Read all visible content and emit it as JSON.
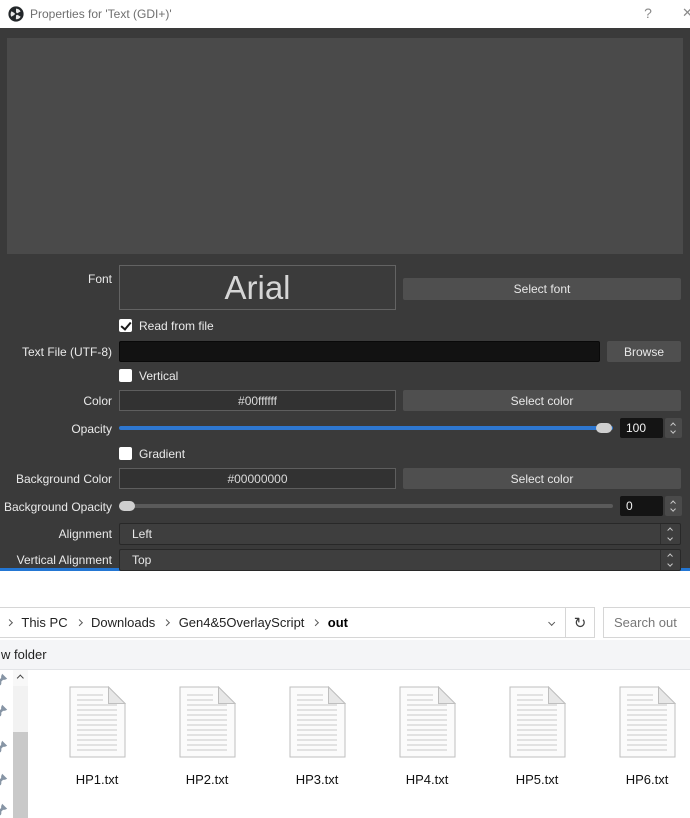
{
  "titlebar": {
    "title": "Properties for 'Text (GDI+)'",
    "help": "?",
    "close": "✕"
  },
  "dialog": {
    "font_label": "Font",
    "font_value": "Arial",
    "select_font_button": "Select font",
    "read_from_file_label": "Read from file",
    "read_from_file_checked": true,
    "text_file_label": "Text File (UTF-8)",
    "text_file_value": "",
    "browse_button": "Browse",
    "vertical_label": "Vertical",
    "vertical_checked": false,
    "color_label": "Color",
    "color_value": "#00ffffff",
    "select_color_button": "Select color",
    "opacity_label": "Opacity",
    "opacity_value": "100",
    "gradient_label": "Gradient",
    "gradient_checked": false,
    "background_color_label": "Background Color",
    "background_color_value": "#00000000",
    "background_select_color_button": "Select color",
    "background_opacity_label": "Background Opacity",
    "background_opacity_value": "0",
    "alignment_label": "Alignment",
    "alignment_value": "Left",
    "vertical_alignment_label": "Vertical Alignment",
    "vertical_alignment_value": "Top"
  },
  "colors": {
    "slider_accent": "#2e77d0",
    "dialog_bg": "#3a3a3a",
    "preview_bg": "#4a4a4a",
    "dialog_bottom_border": "#2376d3"
  },
  "explorer": {
    "breadcrumb": [
      "This PC",
      "Downloads",
      "Gen4&5OverlayScript",
      "out"
    ],
    "refresh_icon": "↻",
    "search_placeholder": "Search out",
    "toolbar_text": "w folder",
    "files": [
      "HP1.txt",
      "HP2.txt",
      "HP3.txt",
      "HP4.txt",
      "HP5.txt",
      "HP6.txt"
    ]
  }
}
